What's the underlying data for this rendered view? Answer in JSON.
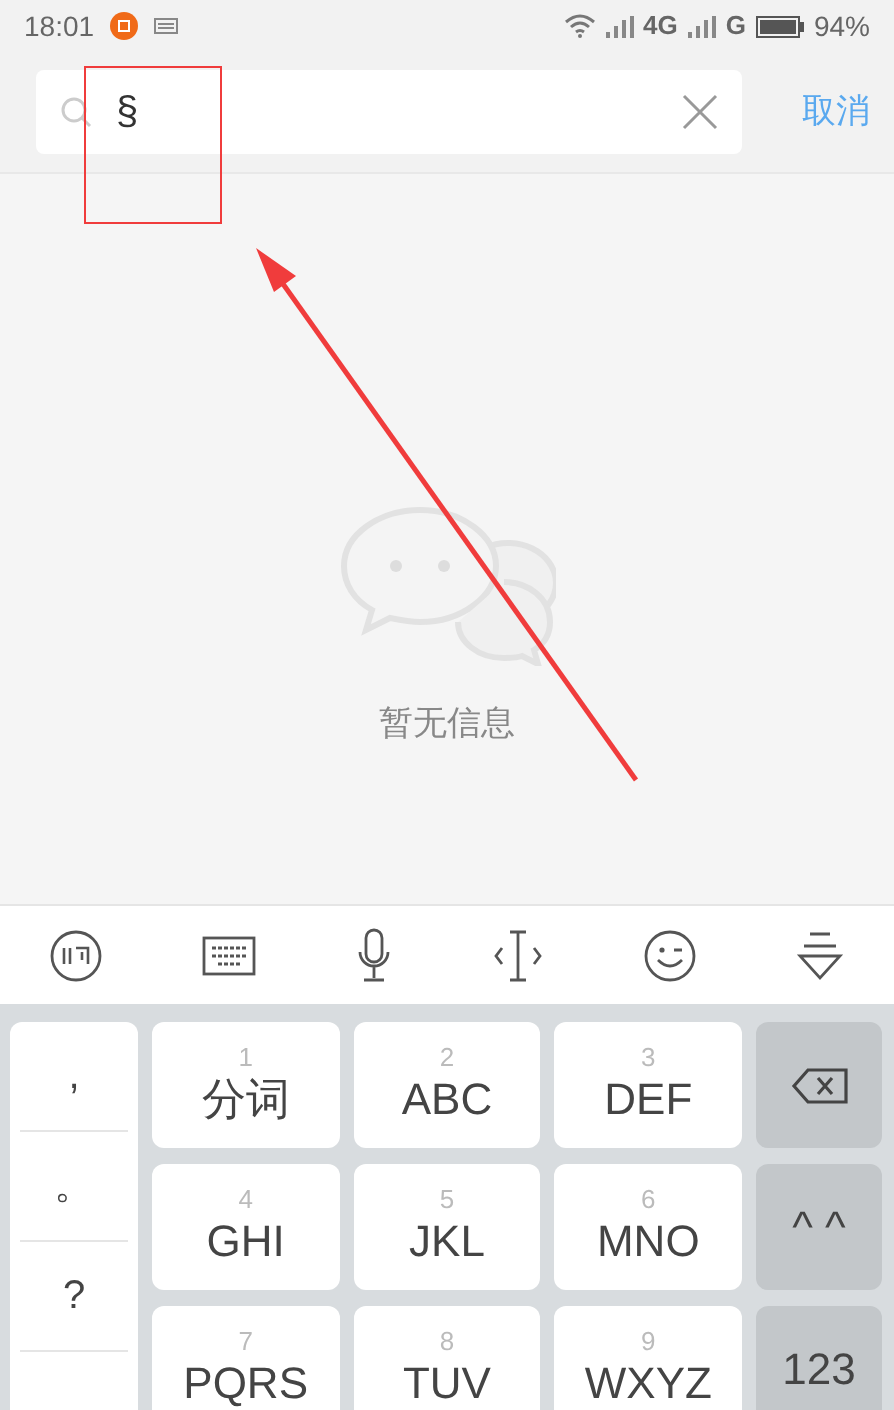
{
  "status_bar": {
    "time": "18:01",
    "network_1": "4G",
    "network_2": "G",
    "battery": "94%"
  },
  "search": {
    "value": "§",
    "cancel": "取消"
  },
  "empty_state": {
    "text": "暂无信息"
  },
  "keyboard": {
    "side_keys": [
      ",",
      "。",
      "?"
    ],
    "keys": [
      {
        "number": "1",
        "label": "分词"
      },
      {
        "number": "2",
        "label": "ABC"
      },
      {
        "number": "3",
        "label": "DEF"
      },
      {
        "number": "4",
        "label": "GHI"
      },
      {
        "number": "5",
        "label": "JKL"
      },
      {
        "number": "6",
        "label": "MNO"
      },
      {
        "number": "7",
        "label": "PQRS"
      },
      {
        "number": "8",
        "label": "TUV"
      },
      {
        "number": "9",
        "label": "WXYZ"
      }
    ],
    "function_keys": [
      {
        "kind": "backspace"
      },
      {
        "kind": "text",
        "label": "^ ^"
      },
      {
        "kind": "text",
        "label": "123"
      }
    ]
  }
}
